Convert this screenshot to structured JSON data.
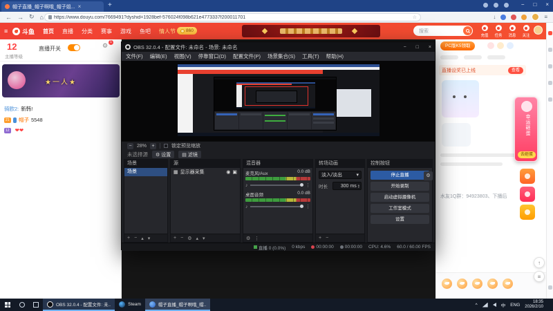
{
  "glyphs": {
    "close": "×",
    "min": "−",
    "max": "□",
    "plus": "+",
    "minus": "−",
    "back": "←",
    "forward": "→",
    "reload": "↻",
    "home": "⌂",
    "star": "☆",
    "down": "↓",
    "menu": "≡",
    "caret": "▾",
    "dots3": "⋮",
    "note": "♪",
    "gear": "⚙",
    "eye": "◉",
    "lock": "▣",
    "monitor": "▦",
    "filter": "▤",
    "up_arrow": "↑",
    "chev_up": "^",
    "spin_up": "▴",
    "spin_down": "▾"
  },
  "browser": {
    "tab_title": "帽子直播_帽子啊哦_帽子姐...",
    "url": "https://www.douyu.com/7669491?dyshid=1928bef-576024f098b621e4773337f200011701"
  },
  "douyu": {
    "logo_text": "斗鱼",
    "nav": [
      "首页",
      "直播",
      "分类",
      "赛事",
      "游戏",
      "鱼吧",
      "情人节"
    ],
    "coin_badge": "860",
    "search_placeholder": "搜索",
    "header_icons": [
      {
        "label": "充值"
      },
      {
        "label": "任务"
      },
      {
        "label": "消息"
      },
      {
        "label": "关注"
      }
    ],
    "sidebar": {
      "level": "12",
      "level_label": "主播等级",
      "live_switch": "直播开关",
      "gear_badge": "1",
      "banner_title": "★一人★",
      "chat": [
        {
          "badge": "",
          "user": "骑欧2:",
          "msg": "新韩!"
        },
        {
          "badge": "21",
          "user": "帽子",
          "msg": "5548"
        },
        {
          "badge": "12",
          "user": "",
          "msg": "❤❤"
        }
      ]
    },
    "right_panel": {
      "promo_button": "PC版K5领取",
      "banner_text": "直播设奖已上线",
      "banner_button": "查看",
      "notice": "水友1Q群：94923803、下播后",
      "wish_title": "幸运砸蛋",
      "wish_button": "去砸蛋"
    }
  },
  "obs": {
    "title": "OBS 32.0.4 - 配置文件: 未命名 - 场景: 未命名",
    "menu": [
      "文件(F)",
      "编辑(E)",
      "视图(V)",
      "停靠窗口(D)",
      "配置文件(P)",
      "场景集合(S)",
      "工具(T)",
      "帮助(H)"
    ],
    "zoom_value": "28%",
    "zoom_lock_label": "锁定预览缩放",
    "no_source_label": "未选择源",
    "settings_btn": "设置",
    "filters_btn": "滤镜",
    "docks": {
      "scenes": {
        "title": "场景",
        "item": "场景"
      },
      "sources": {
        "title": "源",
        "item": "显示器采集"
      },
      "mixer": {
        "title": "混音器",
        "ch1_name": "麦克风/Aux",
        "ch1_db": "0.0 dB",
        "ch2_name": "桌面音频",
        "ch2_db": "0.0 dB"
      },
      "transitions": {
        "title": "转场动画",
        "selected": "淡入/淡出",
        "duration_label": "时长",
        "duration": "300 ms"
      },
      "controls": {
        "title": "控制按钮",
        "stop_stream": "停止直播",
        "start_record": "开始录制",
        "virtual_cam": "启动虚拟摄像机",
        "studio_mode": "工作室模式",
        "settings": "设置"
      }
    },
    "status": {
      "dropped": "直播 0 (0.0%)",
      "bitrate": "0 kbps",
      "stream_time": "00:00:00",
      "record_time": "00:00:00",
      "cpu": "CPU: 4.6%",
      "fps": "60.0 / 60.00 FPS"
    }
  },
  "taskbar": {
    "apps": [
      {
        "label": "OBS 32.0.4 - 配置文件: 未.."
      },
      {
        "label": "Steam"
      },
      {
        "label": "帽子直播_帽子啊哦_帽.."
      }
    ],
    "lang_cn": "中",
    "lang_en": "ENG",
    "time": "18:35",
    "date": "2026/2/10"
  }
}
